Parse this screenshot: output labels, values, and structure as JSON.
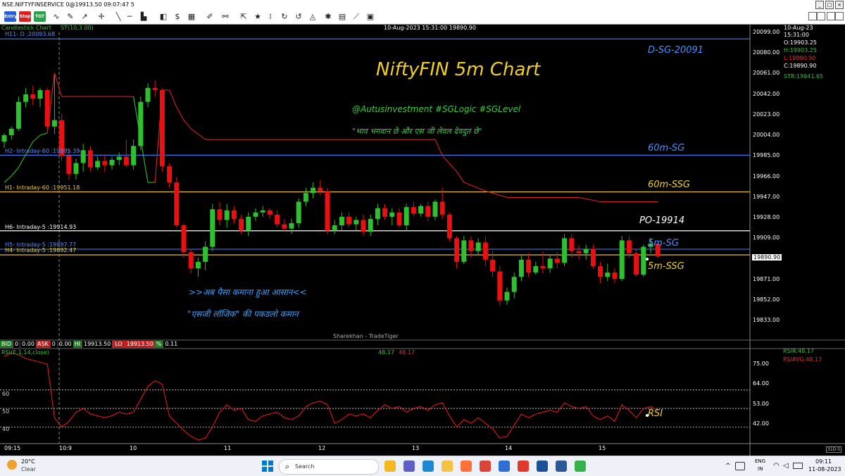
{
  "window": {
    "title": "NSE.NIFTYFINSERVICE 0@19913.50 09:07:47 5",
    "controls": [
      "_",
      "□",
      "×"
    ]
  },
  "toolbar": {
    "badges": [
      {
        "label": "Entry",
        "color": "#2a5bd7"
      },
      {
        "label": "Stop",
        "color": "#d82020"
      },
      {
        "label": "TGT",
        "color": "#2aa04a"
      }
    ],
    "tool_icons": [
      "wave-icon",
      "line-tools-icon",
      "crosshair-icon",
      "chart-bar-icon",
      "box-icon",
      "dollar-icon",
      "pencil-icon",
      "star-icon",
      "refresh-icon",
      "history-icon",
      "dots-icon",
      "calculator-icon",
      "indicator-icon"
    ],
    "right_controls": [
      "▲",
      "▼",
      "□",
      "×"
    ]
  },
  "chart_header": {
    "chart_type": "Candlestick Chart",
    "indicator": "ST(10,3.00)",
    "date_line": "10-Aug-2023  15:31:00  19890.90"
  },
  "info_panel": {
    "date": "10-Aug-23",
    "time": "15:31:00",
    "open": "O:19903.25",
    "high": "H:19903.25",
    "low": "L:19890.90",
    "close": "C:19890.90",
    "str": "STR:19941.65"
  },
  "annotations": {
    "title": "NiftyFIN 5m Chart",
    "tags": "@Autusinvestment  #SGLogic  #SGLevel",
    "quote": "\"भाव भगवान छे और एस जी लेवल देवदुत छे\"",
    "slogan1": ">>अब पैसा कमाना हुआ आसान<<",
    "slogan2": "\"एसजी लॉजिक\" की पकडलो कमान",
    "watermark": "Sharekhan - TradeTiger",
    "rsi_tag": "RSI"
  },
  "levels": [
    {
      "name": "H11",
      "label": "H11- D :20093.68",
      "value": 20093.68,
      "color": "#3a74e8",
      "tag": "D-SG-20091",
      "tag_color": "#4a90ff"
    },
    {
      "name": "H2",
      "label": "H2- Intraday-60 :19985.39",
      "value": 19985.39,
      "color": "#3a74e8",
      "tag": "60m-SG",
      "tag_color": "#4a90ff"
    },
    {
      "name": "H1",
      "label": "H1- Intraday-60 :19951.18",
      "value": 19951.18,
      "color": "#e8c020",
      "tag": "60m-SSG",
      "tag_color": "#f0d020"
    },
    {
      "name": "H6",
      "label": "H6- Intraday-5 :19914.93",
      "value": 19914.93,
      "color": "#ffffff",
      "tag": "PO-19914",
      "tag_color": "#ffffff"
    },
    {
      "name": "H5",
      "label": "H5- Intraday-5 :19897.77",
      "value": 19897.77,
      "color": "#3a74e8",
      "tag": "5m-SG",
      "tag_color": "#4a90ff"
    },
    {
      "name": "H4",
      "label": "H4- Intraday-5 :19892.47",
      "value": 19892.47,
      "color": "#e8c020",
      "tag": "5m-SSG",
      "tag_color": "#f0d020"
    }
  ],
  "price_axis": {
    "ticks": [
      "20099.00",
      "20080.00",
      "20061.00",
      "20042.00",
      "20023.00",
      "20004.00",
      "19985.00",
      "19966.00",
      "19947.00",
      "19928.00",
      "19909.00",
      "19871.00",
      "19852.00",
      "19833.00"
    ],
    "current": "19890.90"
  },
  "quote_bar": [
    {
      "label": "BID",
      "bg": "#1e7b1e"
    },
    {
      "label": "0",
      "bg": "#000"
    },
    {
      "label": "0.00",
      "bg": "#000"
    },
    {
      "label": "ASK",
      "bg": "#c02020"
    },
    {
      "label": "0",
      "bg": "#000"
    },
    {
      "label": "0.00",
      "bg": "#000"
    },
    {
      "label": "HI",
      "bg": "#1e7b1e"
    },
    {
      "label": "19913.50",
      "bg": "#000"
    },
    {
      "label": "LO",
      "bg": "#c02020"
    },
    {
      "label": "19913.50",
      "bg": "#000"
    },
    {
      "label": "%",
      "bg": "#1e7b1e"
    },
    {
      "label": "0.11",
      "bg": "#000"
    }
  ],
  "rsi_panel": {
    "label": "RSI(E,1,14,close)",
    "value1": "48.17",
    "value2": "48.17",
    "rsir": "RSIR:48.17",
    "rsiavg": "RSIAVG:48.17",
    "axis_ticks": [
      "75.00",
      "64.00",
      "53.00",
      "42.00"
    ],
    "left_ticks": [
      "60",
      "50",
      "40"
    ]
  },
  "time_axis": {
    "ticks": [
      "09:15",
      "10:9",
      "10",
      "11",
      "12",
      "13",
      "14",
      "15"
    ],
    "corner": "31D-5"
  },
  "chart_data": {
    "type": "candlestick",
    "title": "NiftyFIN 5m Chart",
    "ylim": [
      19819,
      20105
    ],
    "candles": [
      {
        "o": 19998,
        "h": 20006,
        "l": 19992,
        "c": 20004
      },
      {
        "o": 20004,
        "h": 20012,
        "l": 20000,
        "c": 20010
      },
      {
        "o": 20010,
        "h": 20040,
        "l": 20008,
        "c": 20035
      },
      {
        "o": 20035,
        "h": 20048,
        "l": 20030,
        "c": 20042
      },
      {
        "o": 20042,
        "h": 20050,
        "l": 20032,
        "c": 20038
      },
      {
        "o": 20038,
        "h": 20048,
        "l": 20030,
        "c": 20046
      },
      {
        "o": 20046,
        "h": 20048,
        "l": 20008,
        "c": 20012
      },
      {
        "o": 20012,
        "h": 20060,
        "l": 20005,
        "c": 20018
      },
      {
        "o": 20018,
        "h": 20024,
        "l": 19980,
        "c": 19985
      },
      {
        "o": 19985,
        "h": 19990,
        "l": 19962,
        "c": 19968
      },
      {
        "o": 19968,
        "h": 19982,
        "l": 19963,
        "c": 19978
      },
      {
        "o": 19978,
        "h": 19996,
        "l": 19970,
        "c": 19990
      },
      {
        "o": 19990,
        "h": 19994,
        "l": 19970,
        "c": 19974
      },
      {
        "o": 19974,
        "h": 19984,
        "l": 19972,
        "c": 19980
      },
      {
        "o": 19980,
        "h": 19986,
        "l": 19970,
        "c": 19976
      },
      {
        "o": 19976,
        "h": 19984,
        "l": 19972,
        "c": 19981
      },
      {
        "o": 19981,
        "h": 19988,
        "l": 19976,
        "c": 19984
      },
      {
        "o": 19984,
        "h": 20000,
        "l": 19974,
        "c": 19976
      },
      {
        "o": 19976,
        "h": 20000,
        "l": 19972,
        "c": 19994
      },
      {
        "o": 19994,
        "h": 20040,
        "l": 19990,
        "c": 20035
      },
      {
        "o": 20035,
        "h": 20052,
        "l": 20030,
        "c": 20048
      },
      {
        "o": 20048,
        "h": 20055,
        "l": 20040,
        "c": 20046
      },
      {
        "o": 20046,
        "h": 20048,
        "l": 19970,
        "c": 19975
      },
      {
        "o": 19975,
        "h": 19978,
        "l": 19955,
        "c": 19960
      },
      {
        "o": 19960,
        "h": 19965,
        "l": 19918,
        "c": 19920
      },
      {
        "o": 19920,
        "h": 19922,
        "l": 19890,
        "c": 19895
      },
      {
        "o": 19895,
        "h": 19898,
        "l": 19875,
        "c": 19880
      },
      {
        "o": 19880,
        "h": 19890,
        "l": 19872,
        "c": 19886
      },
      {
        "o": 19886,
        "h": 19905,
        "l": 19878,
        "c": 19900
      },
      {
        "o": 19900,
        "h": 19940,
        "l": 19896,
        "c": 19935
      },
      {
        "o": 19935,
        "h": 19942,
        "l": 19920,
        "c": 19925
      },
      {
        "o": 19925,
        "h": 19940,
        "l": 19918,
        "c": 19934
      },
      {
        "o": 19934,
        "h": 19938,
        "l": 19922,
        "c": 19926
      },
      {
        "o": 19926,
        "h": 19930,
        "l": 19912,
        "c": 19915
      },
      {
        "o": 19915,
        "h": 19932,
        "l": 19910,
        "c": 19928
      },
      {
        "o": 19928,
        "h": 19936,
        "l": 19924,
        "c": 19932
      },
      {
        "o": 19932,
        "h": 19938,
        "l": 19928,
        "c": 19934
      },
      {
        "o": 19934,
        "h": 19936,
        "l": 19926,
        "c": 19930
      },
      {
        "o": 19930,
        "h": 19934,
        "l": 19918,
        "c": 19921
      },
      {
        "o": 19921,
        "h": 19926,
        "l": 19914,
        "c": 19917
      },
      {
        "o": 19917,
        "h": 19926,
        "l": 19912,
        "c": 19922
      },
      {
        "o": 19922,
        "h": 19945,
        "l": 19918,
        "c": 19942
      },
      {
        "o": 19942,
        "h": 19955,
        "l": 19938,
        "c": 19950
      },
      {
        "o": 19950,
        "h": 19960,
        "l": 19945,
        "c": 19955
      },
      {
        "o": 19955,
        "h": 19962,
        "l": 19948,
        "c": 19952
      },
      {
        "o": 19952,
        "h": 19955,
        "l": 19912,
        "c": 19915
      },
      {
        "o": 19915,
        "h": 19925,
        "l": 19912,
        "c": 19920
      },
      {
        "o": 19920,
        "h": 19932,
        "l": 19915,
        "c": 19928
      },
      {
        "o": 19928,
        "h": 19932,
        "l": 19918,
        "c": 19921
      },
      {
        "o": 19921,
        "h": 19928,
        "l": 19915,
        "c": 19925
      },
      {
        "o": 19925,
        "h": 19930,
        "l": 19910,
        "c": 19914
      },
      {
        "o": 19914,
        "h": 19930,
        "l": 19910,
        "c": 19926
      },
      {
        "o": 19926,
        "h": 19940,
        "l": 19920,
        "c": 19936
      },
      {
        "o": 19936,
        "h": 19940,
        "l": 19925,
        "c": 19928
      },
      {
        "o": 19928,
        "h": 19936,
        "l": 19920,
        "c": 19932
      },
      {
        "o": 19932,
        "h": 19936,
        "l": 19918,
        "c": 19920
      },
      {
        "o": 19920,
        "h": 19940,
        "l": 19915,
        "c": 19937
      },
      {
        "o": 19937,
        "h": 19942,
        "l": 19928,
        "c": 19931
      },
      {
        "o": 19931,
        "h": 19940,
        "l": 19928,
        "c": 19938
      },
      {
        "o": 19938,
        "h": 19942,
        "l": 19924,
        "c": 19928
      },
      {
        "o": 19928,
        "h": 19944,
        "l": 19925,
        "c": 19942
      },
      {
        "o": 19942,
        "h": 19955,
        "l": 19926,
        "c": 19930
      },
      {
        "o": 19930,
        "h": 19932,
        "l": 19905,
        "c": 19908
      },
      {
        "o": 19908,
        "h": 19910,
        "l": 19880,
        "c": 19886
      },
      {
        "o": 19886,
        "h": 19910,
        "l": 19884,
        "c": 19906
      },
      {
        "o": 19906,
        "h": 19910,
        "l": 19890,
        "c": 19896
      },
      {
        "o": 19896,
        "h": 19908,
        "l": 19892,
        "c": 19904
      },
      {
        "o": 19904,
        "h": 19910,
        "l": 19882,
        "c": 19888
      },
      {
        "o": 19888,
        "h": 19896,
        "l": 19872,
        "c": 19877
      },
      {
        "o": 19877,
        "h": 19882,
        "l": 19845,
        "c": 19850
      },
      {
        "o": 19850,
        "h": 19862,
        "l": 19846,
        "c": 19858
      },
      {
        "o": 19858,
        "h": 19876,
        "l": 19852,
        "c": 19872
      },
      {
        "o": 19872,
        "h": 19892,
        "l": 19868,
        "c": 19888
      },
      {
        "o": 19888,
        "h": 19894,
        "l": 19872,
        "c": 19876
      },
      {
        "o": 19876,
        "h": 19886,
        "l": 19874,
        "c": 19882
      },
      {
        "o": 19882,
        "h": 19896,
        "l": 19875,
        "c": 19880
      },
      {
        "o": 19880,
        "h": 19892,
        "l": 19876,
        "c": 19889
      },
      {
        "o": 19889,
        "h": 19895,
        "l": 19880,
        "c": 19885
      },
      {
        "o": 19885,
        "h": 19912,
        "l": 19882,
        "c": 19908
      },
      {
        "o": 19908,
        "h": 19912,
        "l": 19890,
        "c": 19896
      },
      {
        "o": 19896,
        "h": 19902,
        "l": 19888,
        "c": 19894
      },
      {
        "o": 19894,
        "h": 19902,
        "l": 19888,
        "c": 19898
      },
      {
        "o": 19898,
        "h": 19902,
        "l": 19880,
        "c": 19882
      },
      {
        "o": 19882,
        "h": 19886,
        "l": 19866,
        "c": 19872
      },
      {
        "o": 19872,
        "h": 19884,
        "l": 19868,
        "c": 19876
      },
      {
        "o": 19876,
        "h": 19880,
        "l": 19866,
        "c": 19870
      },
      {
        "o": 19870,
        "h": 19910,
        "l": 19868,
        "c": 19906
      },
      {
        "o": 19906,
        "h": 19910,
        "l": 19890,
        "c": 19894
      },
      {
        "o": 19894,
        "h": 19898,
        "l": 19872,
        "c": 19874
      },
      {
        "o": 19874,
        "h": 19902,
        "l": 19872,
        "c": 19900
      },
      {
        "o": 19900,
        "h": 19908,
        "l": 19894,
        "c": 19903
      },
      {
        "o": 19903,
        "h": 19903,
        "l": 19890,
        "c": 19891
      }
    ],
    "supertrend": [
      {
        "i": 0,
        "v": 19960,
        "c": "green"
      },
      {
        "i": 1,
        "v": 19966,
        "c": "green"
      },
      {
        "i": 2,
        "v": 19974,
        "c": "green"
      },
      {
        "i": 3,
        "v": 19986,
        "c": "green"
      },
      {
        "i": 4,
        "v": 19998,
        "c": "green"
      },
      {
        "i": 5,
        "v": 20004,
        "c": "green"
      },
      {
        "i": 6,
        "v": 20006,
        "c": "green"
      },
      {
        "i": 7,
        "v": 20062,
        "c": "red"
      },
      {
        "i": 8,
        "v": 20040,
        "c": "red"
      },
      {
        "i": 9,
        "v": 20040,
        "c": "red"
      },
      {
        "i": 10,
        "v": 20040,
        "c": "red"
      },
      {
        "i": 11,
        "v": 20040,
        "c": "red"
      },
      {
        "i": 12,
        "v": 20040,
        "c": "red"
      },
      {
        "i": 13,
        "v": 20040,
        "c": "red"
      },
      {
        "i": 14,
        "v": 20040,
        "c": "red"
      },
      {
        "i": 15,
        "v": 20040,
        "c": "red"
      },
      {
        "i": 16,
        "v": 20040,
        "c": "red"
      },
      {
        "i": 17,
        "v": 20040,
        "c": "red"
      },
      {
        "i": 18,
        "v": 20040,
        "c": "red"
      },
      {
        "i": 19,
        "v": 20000,
        "c": "green"
      },
      {
        "i": 20,
        "v": 19960,
        "c": "green"
      },
      {
        "i": 21,
        "v": 19960,
        "c": "green"
      },
      {
        "i": 22,
        "v": 20046,
        "c": "red"
      },
      {
        "i": 23,
        "v": 20046,
        "c": "red"
      },
      {
        "i": 24,
        "v": 20030,
        "c": "red"
      },
      {
        "i": 25,
        "v": 20018,
        "c": "red"
      },
      {
        "i": 26,
        "v": 20010,
        "c": "red"
      },
      {
        "i": 27,
        "v": 20005,
        "c": "red"
      },
      {
        "i": 28,
        "v": 20000,
        "c": "red"
      },
      {
        "i": 29,
        "v": 20000,
        "c": "red"
      },
      {
        "i": 40,
        "v": 20000,
        "c": "red"
      },
      {
        "i": 60,
        "v": 20000,
        "c": "red"
      },
      {
        "i": 61,
        "v": 19985,
        "c": "red"
      },
      {
        "i": 63,
        "v": 19970,
        "c": "red"
      },
      {
        "i": 64,
        "v": 19960,
        "c": "red"
      },
      {
        "i": 67,
        "v": 19952,
        "c": "red"
      },
      {
        "i": 70,
        "v": 19946,
        "c": "red"
      },
      {
        "i": 80,
        "v": 19946,
        "c": "red"
      },
      {
        "i": 83,
        "v": 19942,
        "c": "red"
      },
      {
        "i": 91,
        "v": 19942,
        "c": "red"
      }
    ],
    "rsi": [
      78,
      80,
      79,
      77,
      76,
      75,
      74,
      45,
      40,
      43,
      48,
      50,
      47,
      46,
      45,
      46,
      48,
      47,
      48,
      55,
      62,
      65,
      63,
      46,
      42,
      38,
      35,
      33,
      34,
      40,
      48,
      52,
      49,
      50,
      44,
      43,
      46,
      47,
      48,
      45,
      44,
      46,
      51,
      53,
      54,
      52,
      42,
      44,
      47,
      46,
      47,
      45,
      49,
      52,
      50,
      51,
      48,
      50,
      51,
      49,
      52,
      53,
      46,
      40,
      44,
      42,
      45,
      42,
      39,
      34,
      35,
      41,
      47,
      45,
      47,
      48,
      49,
      48,
      53,
      51,
      50,
      51,
      46,
      44,
      46,
      43,
      52,
      49,
      45,
      50,
      51,
      49
    ],
    "rsi_ylim": [
      31,
      82
    ]
  },
  "taskbar": {
    "weather_temp": "20°C",
    "weather_desc": "Clear",
    "search_placeholder": "Search",
    "lang1": "ENG",
    "lang2": "IN",
    "time": "09:11",
    "date": "11-08-2023",
    "apps": [
      {
        "name": "file-explorer-icon",
        "color": "#f2b822"
      },
      {
        "name": "video-call-icon",
        "color": "#5b5fc7"
      },
      {
        "name": "edge-icon",
        "color": "#1e88d3"
      },
      {
        "name": "folder-icon",
        "color": "#f5c242"
      },
      {
        "name": "firefox-icon",
        "color": "#ff7139"
      },
      {
        "name": "chrome-icon",
        "color": "#db4437"
      },
      {
        "name": "tradetiger-icon",
        "color": "#2e6fd6"
      },
      {
        "name": "app-red-icon",
        "color": "#e03a2c"
      },
      {
        "name": "sas-icon",
        "color": "#1a4f9c"
      },
      {
        "name": "word-icon",
        "color": "#2b579a"
      },
      {
        "name": "app-green-icon",
        "color": "#36b24a"
      }
    ]
  }
}
